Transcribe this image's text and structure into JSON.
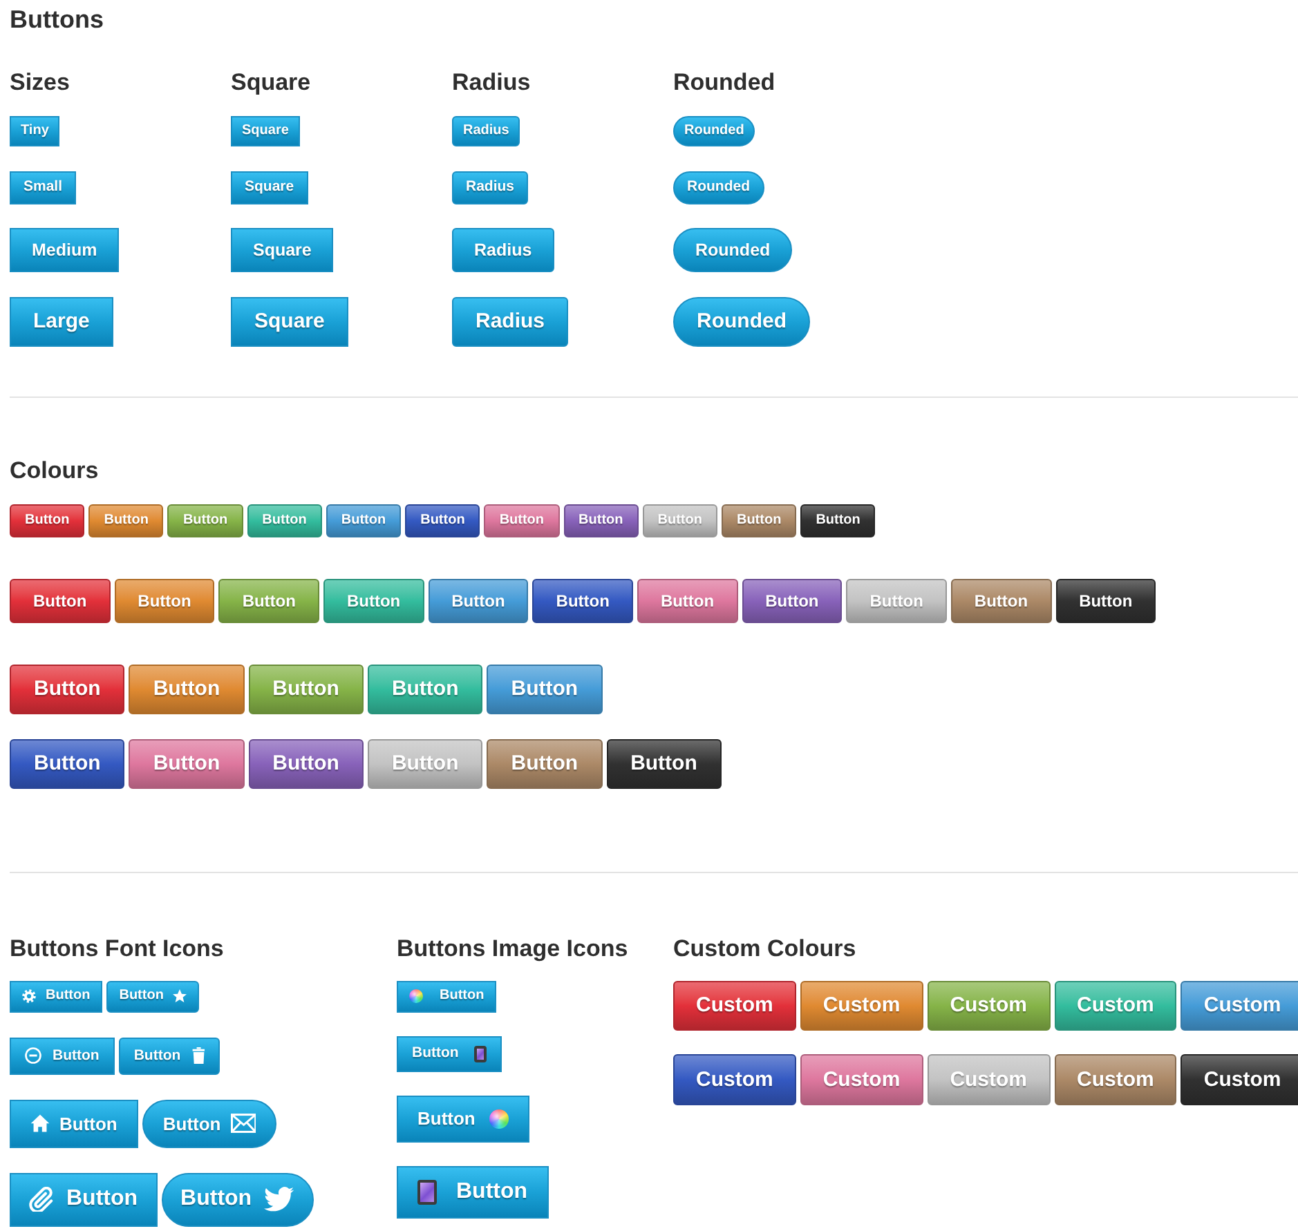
{
  "title": "Buttons",
  "shape_columns": [
    {
      "heading": "Sizes",
      "kind": "square",
      "buttons": [
        "Tiny",
        "Small",
        "Medium",
        "Large"
      ]
    },
    {
      "heading": "Square",
      "kind": "square",
      "buttons": [
        "Square",
        "Square",
        "Square",
        "Square"
      ]
    },
    {
      "heading": "Radius",
      "kind": "radius",
      "buttons": [
        "Radius",
        "Radius",
        "Radius",
        "Radius"
      ]
    },
    {
      "heading": "Rounded",
      "kind": "rounded",
      "buttons": [
        "Rounded",
        "Rounded",
        "Rounded",
        "Rounded"
      ]
    }
  ],
  "colours": {
    "heading": "Colours",
    "rows": [
      {
        "buttons": [
          {
            "label": "Button",
            "color": "#e3303a"
          },
          {
            "label": "Button",
            "color": "#e08a31"
          },
          {
            "label": "Button",
            "color": "#86b448"
          },
          {
            "label": "Button",
            "color": "#33bd9e"
          },
          {
            "label": "Button",
            "color": "#459cd8"
          },
          {
            "label": "Button",
            "color": "#3459c2"
          },
          {
            "label": "Button",
            "color": "#de779e"
          },
          {
            "label": "Button",
            "color": "#8862ba"
          },
          {
            "label": "Button",
            "color": "#c3c3c3"
          },
          {
            "label": "Button",
            "color": "#ac8967"
          },
          {
            "label": "Button",
            "color": "#313131"
          }
        ]
      },
      {
        "buttons": [
          {
            "label": "Button",
            "color": "#e3303a"
          },
          {
            "label": "Button",
            "color": "#e08a31"
          },
          {
            "label": "Button",
            "color": "#86b448"
          },
          {
            "label": "Button",
            "color": "#33bd9e"
          },
          {
            "label": "Button",
            "color": "#459cd8"
          },
          {
            "label": "Button",
            "color": "#3459c2"
          },
          {
            "label": "Button",
            "color": "#de779e"
          },
          {
            "label": "Button",
            "color": "#8862ba"
          },
          {
            "label": "Button",
            "color": "#c3c3c3"
          },
          {
            "label": "Button",
            "color": "#ac8967"
          },
          {
            "label": "Button",
            "color": "#313131"
          }
        ]
      },
      {
        "buttons": [
          {
            "label": "Button",
            "color": "#e3303a"
          },
          {
            "label": "Button",
            "color": "#e08a31"
          },
          {
            "label": "Button",
            "color": "#86b448"
          },
          {
            "label": "Button",
            "color": "#33bd9e"
          },
          {
            "label": "Button",
            "color": "#459cd8"
          }
        ]
      },
      {
        "buttons": [
          {
            "label": "Button",
            "color": "#3459c2"
          },
          {
            "label": "Button",
            "color": "#de779e"
          },
          {
            "label": "Button",
            "color": "#8862ba"
          },
          {
            "label": "Button",
            "color": "#c3c3c3"
          },
          {
            "label": "Button",
            "color": "#ac8967"
          },
          {
            "label": "Button",
            "color": "#313131"
          }
        ]
      }
    ]
  },
  "font_icons": {
    "heading": "Buttons Font Icons",
    "rows": [
      {
        "buttons": [
          {
            "label": "Button",
            "kind": "square"
          },
          {
            "label": "Button",
            "kind": "radius"
          }
        ]
      },
      {
        "buttons": [
          {
            "label": "Button",
            "kind": "square"
          },
          {
            "label": "Button",
            "kind": "radius"
          }
        ]
      },
      {
        "buttons": [
          {
            "label": "Button",
            "kind": "square"
          },
          {
            "label": "Button",
            "kind": "rounded"
          }
        ]
      },
      {
        "buttons": [
          {
            "label": "Button",
            "kind": "square"
          },
          {
            "label": "Button",
            "kind": "rounded"
          }
        ]
      }
    ]
  },
  "image_icons": {
    "heading": "Buttons Image Icons",
    "buttons": [
      "Button",
      "Button",
      "Button",
      "Button"
    ]
  },
  "custom_colours": {
    "heading": "Custom Colours",
    "rows": [
      {
        "buttons": [
          {
            "label": "Custom",
            "color": "#e3303a"
          },
          {
            "label": "Custom",
            "color": "#e08a31"
          },
          {
            "label": "Custom",
            "color": "#86b448"
          },
          {
            "label": "Custom",
            "color": "#33bd9e"
          },
          {
            "label": "Custom",
            "color": "#459cd8"
          }
        ]
      },
      {
        "buttons": [
          {
            "label": "Custom",
            "color": "#3459c2"
          },
          {
            "label": "Custom",
            "color": "#de779e"
          },
          {
            "label": "Custom",
            "color": "#c3c3c3"
          },
          {
            "label": "Custom",
            "color": "#ac8967"
          },
          {
            "label": "Custom",
            "color": "#313131"
          }
        ]
      }
    ]
  }
}
